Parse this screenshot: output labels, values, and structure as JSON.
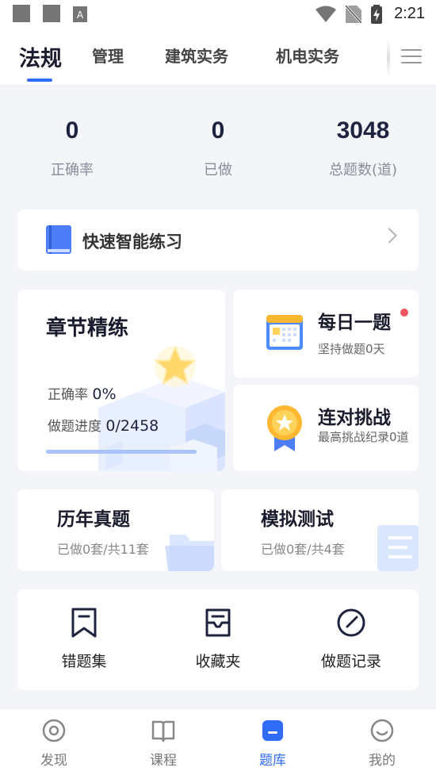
{
  "status_bar": {
    "time": "2:21"
  },
  "tabs": [
    {
      "label": "法规",
      "active": true
    },
    {
      "label": "管理",
      "active": false
    },
    {
      "label": "建筑实务",
      "active": false
    },
    {
      "label": "机电实务",
      "active": false
    }
  ],
  "stats": [
    {
      "value": "0",
      "label": "正确率"
    },
    {
      "value": "0",
      "label": "已做"
    },
    {
      "value": "3048",
      "label": "总题数(道)"
    }
  ],
  "quick_practice": {
    "label": "快速智能练习",
    "icon": "book-icon"
  },
  "chapter_practice": {
    "title": "章节精练",
    "accuracy_label": "正确率",
    "accuracy_value": "0%",
    "progress_label": "做题进度",
    "progress_value": "0/2458",
    "progress_fraction": 0.0
  },
  "daily_question": {
    "title": "每日一题",
    "subtitle": "坚持做题0天",
    "icon": "calendar-icon",
    "badge_color": "#f4545f"
  },
  "streak_challenge": {
    "title": "连对挑战",
    "subtitle": "最高挑战纪录0道",
    "icon": "medal-icon"
  },
  "past_exams": {
    "title": "历年真题",
    "subtitle": "已做0套/共11套"
  },
  "mock_tests": {
    "title": "模拟测试",
    "subtitle": "已做0套/共4套"
  },
  "tools": [
    {
      "label": "错题集",
      "icon": "bookmark-icon"
    },
    {
      "label": "收藏夹",
      "icon": "inbox-icon"
    },
    {
      "label": "做题记录",
      "icon": "gauge-icon"
    }
  ],
  "bottom_nav": [
    {
      "label": "发现",
      "icon": "eye-icon",
      "active": false
    },
    {
      "label": "课程",
      "icon": "open-book-icon",
      "active": false
    },
    {
      "label": "题库",
      "icon": "question-bank-icon",
      "active": true
    },
    {
      "label": "我的",
      "icon": "smiley-icon",
      "active": false
    }
  ],
  "colors": {
    "accent": "#2f6cf6",
    "text_dark": "#1b1b2e",
    "background": "#f4f5f8"
  }
}
